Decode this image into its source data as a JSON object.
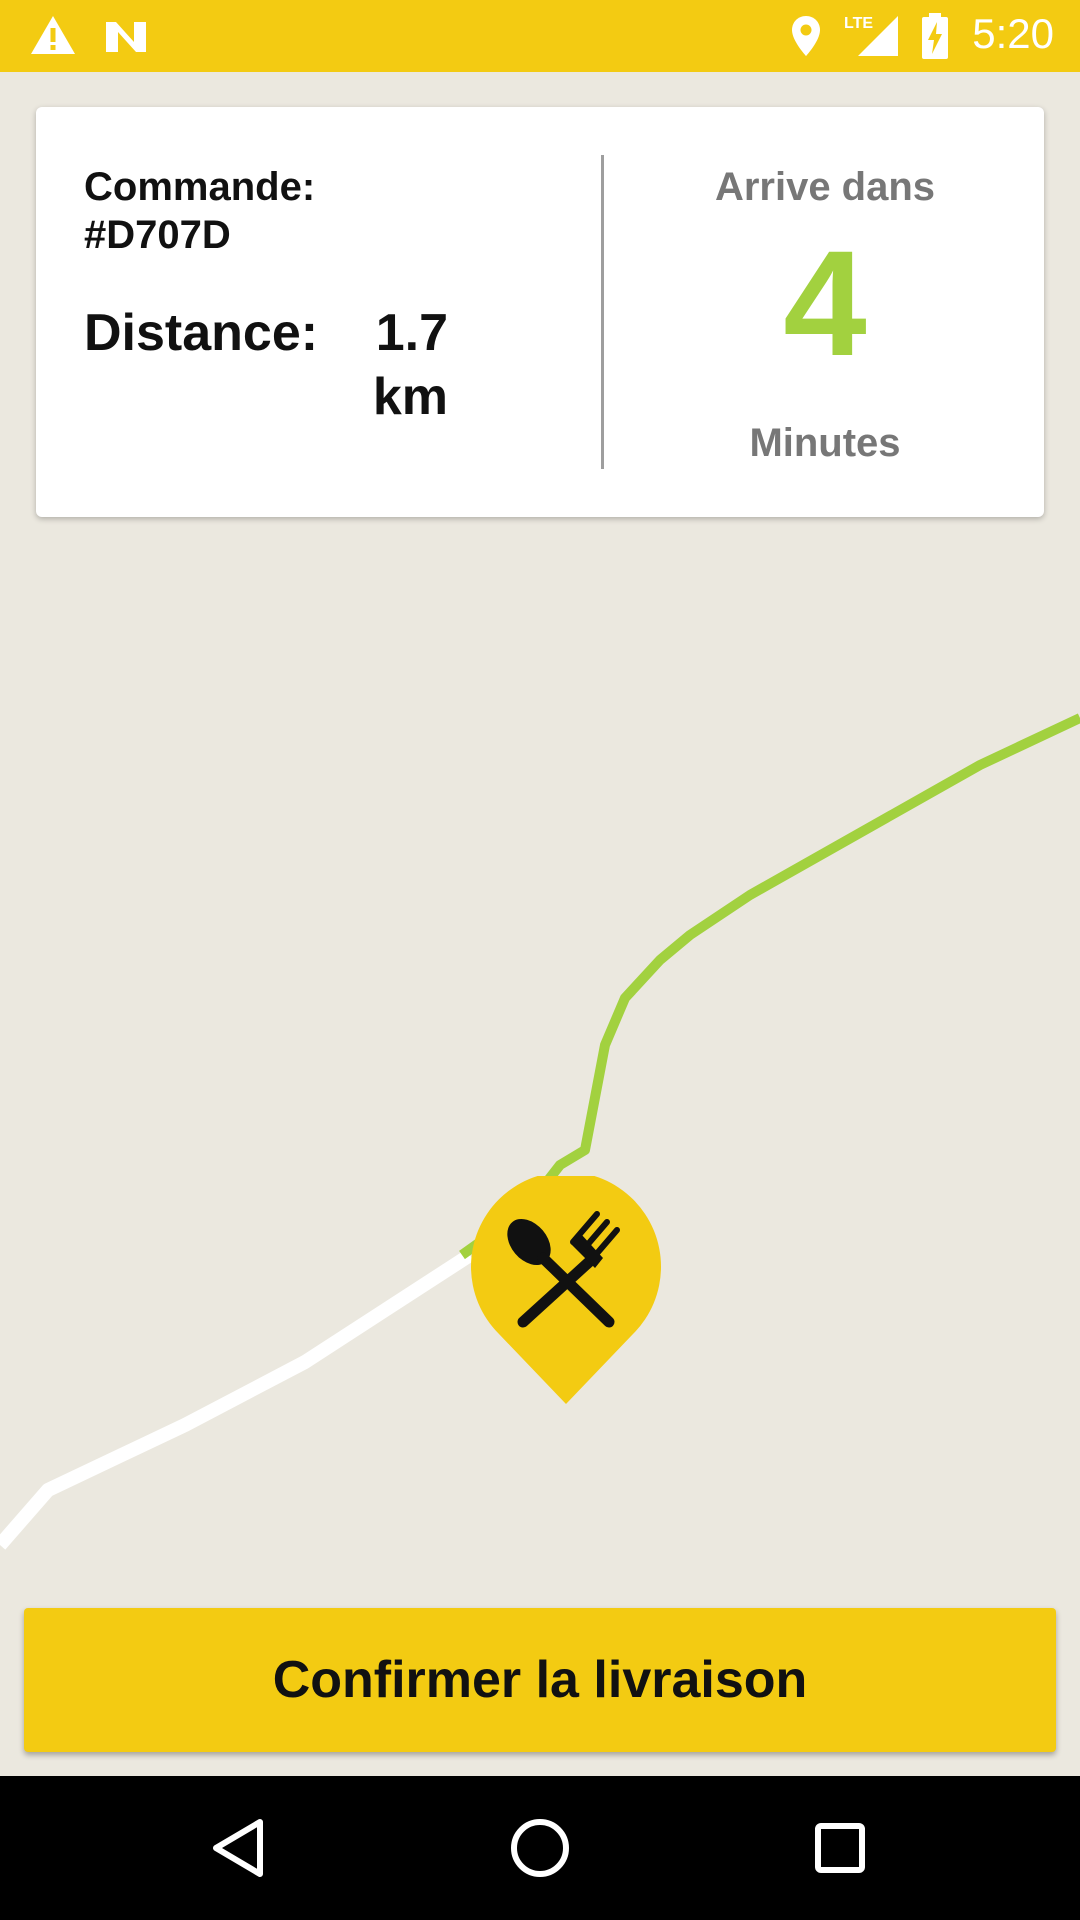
{
  "status_bar": {
    "time": "5:20",
    "icons": [
      "warning-icon",
      "notification-n-icon",
      "location-icon",
      "lte-signal-icon",
      "battery-charging-icon"
    ],
    "network_label": "LTE",
    "background_color": "#f3cb12"
  },
  "order_card": {
    "order_label": "Commande:",
    "order_number": "#D707D",
    "distance_label": "Distance:",
    "distance_value": "1.7 km",
    "arrival_label": "Arrive dans",
    "arrival_value": "4",
    "arrival_unit": "Minutes",
    "arrival_color": "#a2d13f"
  },
  "map": {
    "route_color": "#a2d13f",
    "road_color": "#ffffff",
    "marker_icon": "restaurant-utensils-icon",
    "marker_color": "#f3cb12"
  },
  "confirm_button": {
    "label": "Confirmer la livraison",
    "color": "#f3cb12"
  },
  "nav_bar": {
    "icons": [
      "back-icon",
      "home-icon",
      "recents-icon"
    ]
  }
}
